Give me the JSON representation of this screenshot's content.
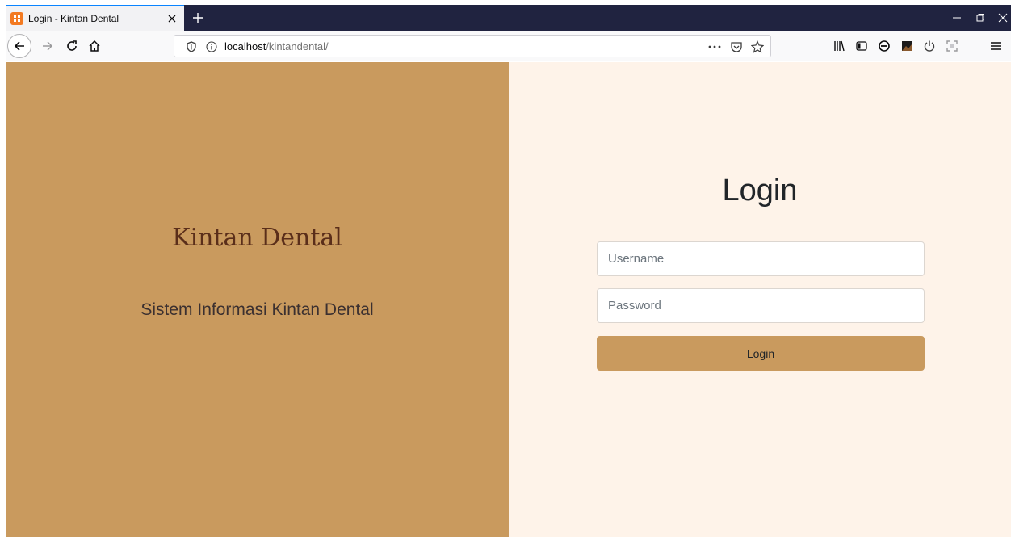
{
  "browser": {
    "tab": {
      "title": "Login - Kintan Dental",
      "favicon": "xampp-icon"
    },
    "new_tab_label": "+",
    "url": {
      "host": "localhost",
      "path": "/kintandental/"
    },
    "colors": {
      "tabbar": "#202340",
      "accent": "#0a84ff"
    }
  },
  "left": {
    "brand": "Kintan Dental",
    "subtitle": "Sistem Informasi Kintan Dental",
    "background": "#c99a5e"
  },
  "login": {
    "title": "Login",
    "username_placeholder": "Username",
    "password_placeholder": "Password",
    "button_label": "Login",
    "background": "#fef3e9"
  }
}
